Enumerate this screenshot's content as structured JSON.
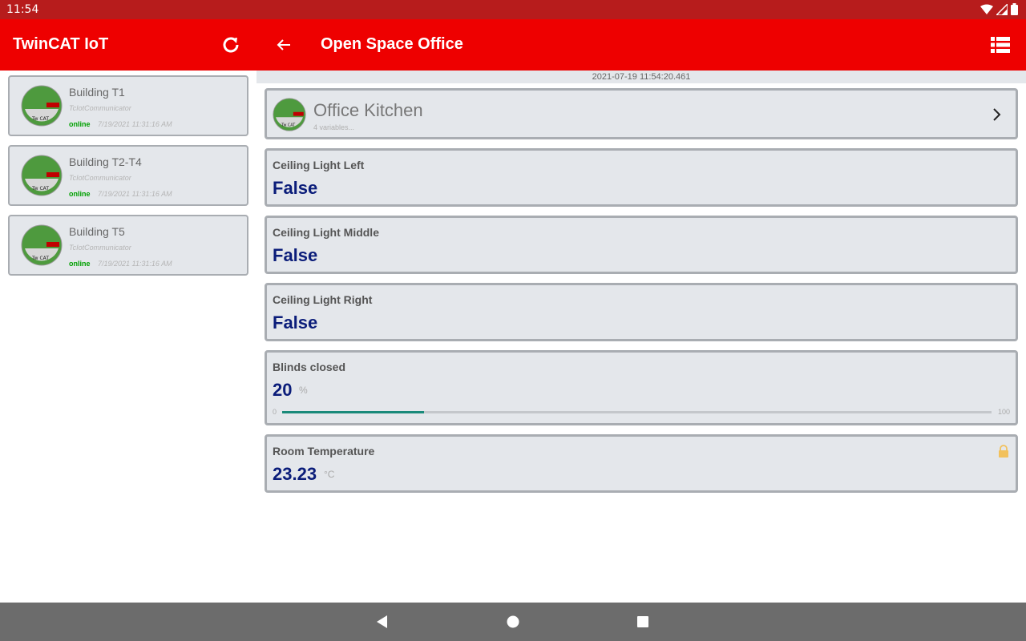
{
  "status_bar": {
    "time": "11:54"
  },
  "left_appbar": {
    "title": "TwinCAT IoT"
  },
  "right_appbar": {
    "title": "Open Space Office"
  },
  "buildings": [
    {
      "name": "Building T1",
      "subtitle": "TcIotCommunicator",
      "status": "online",
      "timestamp": "7/19/2021 11:31:16 AM"
    },
    {
      "name": "Building T2-T4",
      "subtitle": "TcIotCommunicator",
      "status": "online",
      "timestamp": "7/19/2021 11:31:16 AM"
    },
    {
      "name": "Building T5",
      "subtitle": "TcIotCommunicator",
      "status": "online",
      "timestamp": "7/19/2021 11:31:16 AM"
    }
  ],
  "content": {
    "timestamp": "2021-07-19 11:54:20.461",
    "group": {
      "title": "Office Kitchen",
      "subtitle": "4  variables..."
    },
    "variables": [
      {
        "label": "Ceiling Light Left",
        "value": "False"
      },
      {
        "label": "Ceiling Light Middle",
        "value": "False"
      },
      {
        "label": "Ceiling Light Right",
        "value": "False"
      },
      {
        "label": "Blinds closed",
        "value": "20",
        "unit": "%",
        "slider_min": "0",
        "slider_max": "100",
        "fraction": 0.2
      },
      {
        "label": "Room Temperature",
        "value": "23.23",
        "unit": "°C",
        "locked": true
      }
    ]
  },
  "icons": {
    "refresh": "refresh-icon",
    "back": "arrow-back-icon",
    "list_view": "list-view-icon",
    "chevron": "chevron-right-icon",
    "lock": "lock-icon",
    "logo": "twincat-logo"
  },
  "colors": {
    "accent": "#ee0000",
    "status_bar": "#b71c1c",
    "online": "#00a000",
    "value": "#0b1d7a",
    "slider": "#1a8a7a"
  }
}
